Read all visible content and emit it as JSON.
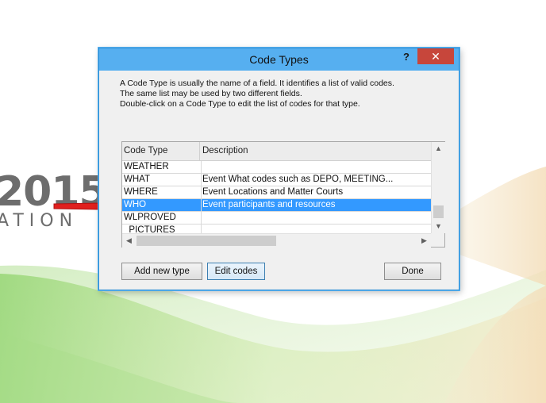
{
  "background": {
    "year_text": "2015",
    "sub_text": "ATION"
  },
  "dialog": {
    "title": "Code Types",
    "help_label": "?",
    "close_label": "✕",
    "description_lines": [
      "A Code Type is usually the name of a field. It identifies a list of valid codes.",
      "The same list may be used by two different fields.",
      "Double-click on a Code Type to edit the list of codes for that type."
    ],
    "grid": {
      "columns": [
        "Code Type",
        "Description"
      ],
      "rows": [
        {
          "code": "WEATHER",
          "description": ""
        },
        {
          "code": "WHAT",
          "description": "Event What codes such as DEPO, MEETING..."
        },
        {
          "code": "WHERE",
          "description": "Event Locations and Matter Courts"
        },
        {
          "code": "WHO",
          "description": "Event participants and resources"
        },
        {
          "code": "WLPROVED",
          "description": ""
        },
        {
          "code": "_PICTURES",
          "description": ""
        }
      ],
      "selected_code": "WHO"
    },
    "buttons": {
      "add_new_type": "Add new type",
      "edit_codes": "Edit codes",
      "done": "Done"
    }
  },
  "colors": {
    "titlebar": "#56aff0",
    "close": "#c7463b",
    "selection": "#3399ff",
    "arrow": "#e0201e"
  }
}
